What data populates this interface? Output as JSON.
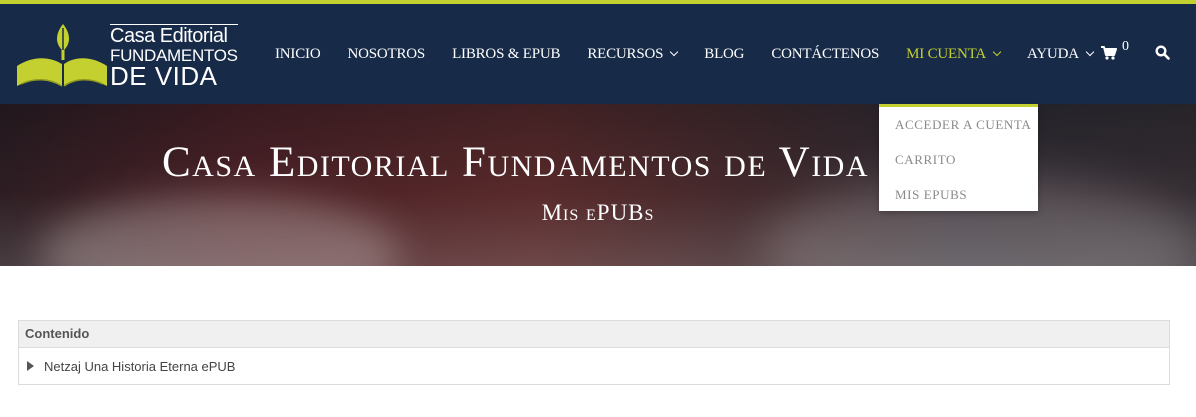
{
  "logo": {
    "line1": "Casa Editorial",
    "line2": "FUNDAMENTOS",
    "line3": "DE VIDA",
    "icon": "open-book-leaf-icon"
  },
  "nav": {
    "items": [
      {
        "label": "INICIO"
      },
      {
        "label": "NOSOTROS"
      },
      {
        "label": "LIBROS & EPUB"
      },
      {
        "label": "RECURSOS",
        "dropdown": true
      },
      {
        "label": "BLOG"
      },
      {
        "label": "CONTÁCTENOS"
      },
      {
        "label": "MI CUENTA",
        "dropdown": true,
        "active": true
      },
      {
        "label": "AYUDA",
        "dropdown": true
      }
    ],
    "cart_count": "0",
    "cart_icon": "shopping-cart-icon",
    "search_icon": "search-icon"
  },
  "hero": {
    "title": "Casa Editorial Fundamentos de Vida",
    "subtitle": "Mis ePUBs"
  },
  "dropdown": {
    "items": [
      {
        "label": "ACCEDER A CUENTA"
      },
      {
        "label": "CARRITO"
      },
      {
        "label": "MIS EPUBS"
      }
    ]
  },
  "content": {
    "header": "Contenido",
    "rows": [
      {
        "label": "Netzaj Una Historia Eterna ePUB"
      }
    ]
  },
  "colors": {
    "header_bg": "#172a48",
    "accent": "#c3d02f",
    "dropdown_text": "#8a8a8a"
  }
}
